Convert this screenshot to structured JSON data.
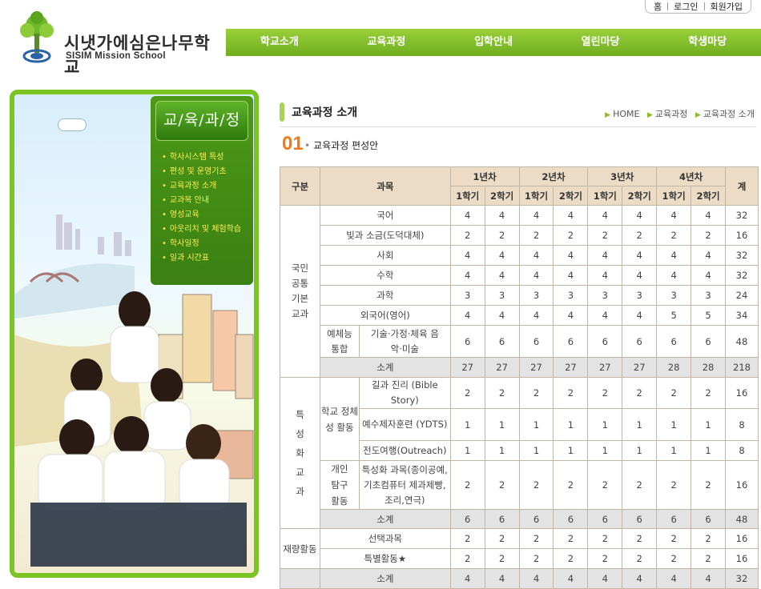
{
  "header": {
    "logo_title": "시냇가에심은나무학교",
    "logo_sub": "SISIM Mission School",
    "util": [
      "홈",
      "로그인",
      "회원가입"
    ],
    "gnb": [
      "학교소개",
      "교육과정",
      "입학안내",
      "열린마당",
      "학생마당"
    ]
  },
  "lnb": {
    "title": "교/육/과/정",
    "items": [
      "학사시스템 특성",
      "편성 및 운영기초",
      "교육과정 소개",
      "교과목 안내",
      "영성교육",
      "아웃리치 및 체험학습",
      "학사일정",
      "일과 시간표"
    ]
  },
  "content": {
    "title": "교육과정 소개",
    "breadcrumb": [
      "HOME",
      "교육과정",
      "교육과정 소개"
    ],
    "section_num": "01",
    "section_title": "교육과정 편성안"
  },
  "table": {
    "h_gubun": "구분",
    "h_subject": "과목",
    "h_total": "계",
    "years": [
      "1년차",
      "2년차",
      "3년차",
      "4년차"
    ],
    "sem": [
      "1학기",
      "2학기"
    ],
    "g1": "국민 공통 기본 교과",
    "g2": "특 성 화 교 과",
    "g1_sub": "예체능 통합",
    "g2_sub1": "학교 정체성 활동",
    "g2_sub2": "개인 탐구 활동",
    "rows": [
      {
        "name": "국어",
        "v": [
          "4",
          "4",
          "4",
          "4",
          "4",
          "4",
          "4",
          "4",
          "32"
        ]
      },
      {
        "name": "빛과 소금(도덕대체)",
        "v": [
          "2",
          "2",
          "2",
          "2",
          "2",
          "2",
          "2",
          "2",
          "16"
        ]
      },
      {
        "name": "사회",
        "v": [
          "4",
          "4",
          "4",
          "4",
          "4",
          "4",
          "4",
          "4",
          "32"
        ]
      },
      {
        "name": "수학",
        "v": [
          "4",
          "4",
          "4",
          "4",
          "4",
          "4",
          "4",
          "4",
          "32"
        ]
      },
      {
        "name": "과학",
        "v": [
          "3",
          "3",
          "3",
          "3",
          "3",
          "3",
          "3",
          "3",
          "24"
        ]
      },
      {
        "name": "외국어(영어)",
        "v": [
          "4",
          "4",
          "4",
          "4",
          "4",
          "4",
          "5",
          "5",
          "34"
        ]
      },
      {
        "name": "기술·가정·체육 음악·미술",
        "v": [
          "6",
          "6",
          "6",
          "6",
          "6",
          "6",
          "6",
          "6",
          "48"
        ]
      },
      {
        "name": "소계",
        "v": [
          "27",
          "27",
          "27",
          "27",
          "27",
          "27",
          "28",
          "28",
          "218"
        ]
      },
      {
        "name": "길과 진리 (Bible Story)",
        "v": [
          "2",
          "2",
          "2",
          "2",
          "2",
          "2",
          "2",
          "2",
          "16"
        ]
      },
      {
        "name": "예수제자훈련 (YDTS)",
        "v": [
          "1",
          "1",
          "1",
          "1",
          "1",
          "1",
          "1",
          "1",
          "8"
        ]
      },
      {
        "name": "전도여행(Outreach)",
        "v": [
          "1",
          "1",
          "1",
          "1",
          "1",
          "1",
          "1",
          "1",
          "8"
        ]
      },
      {
        "name": "특성화 과목(종이공예,기초컴퓨터 제과제빵,조리,연극)",
        "v": [
          "2",
          "2",
          "2",
          "2",
          "2",
          "2",
          "2",
          "2",
          "16"
        ]
      },
      {
        "name": "소계",
        "v": [
          "6",
          "6",
          "6",
          "6",
          "6",
          "6",
          "6",
          "6",
          "48"
        ]
      },
      {
        "name": "선택과목",
        "v": [
          "2",
          "2",
          "2",
          "2",
          "2",
          "2",
          "2",
          "2",
          "16"
        ]
      },
      {
        "name": "특별활동★",
        "v": [
          "2",
          "2",
          "2",
          "2",
          "2",
          "2",
          "2",
          "2",
          "16"
        ]
      },
      {
        "name": "소계",
        "v": [
          "4",
          "4",
          "4",
          "4",
          "4",
          "4",
          "4",
          "4",
          "32"
        ]
      }
    ],
    "g3": "재량활동"
  }
}
